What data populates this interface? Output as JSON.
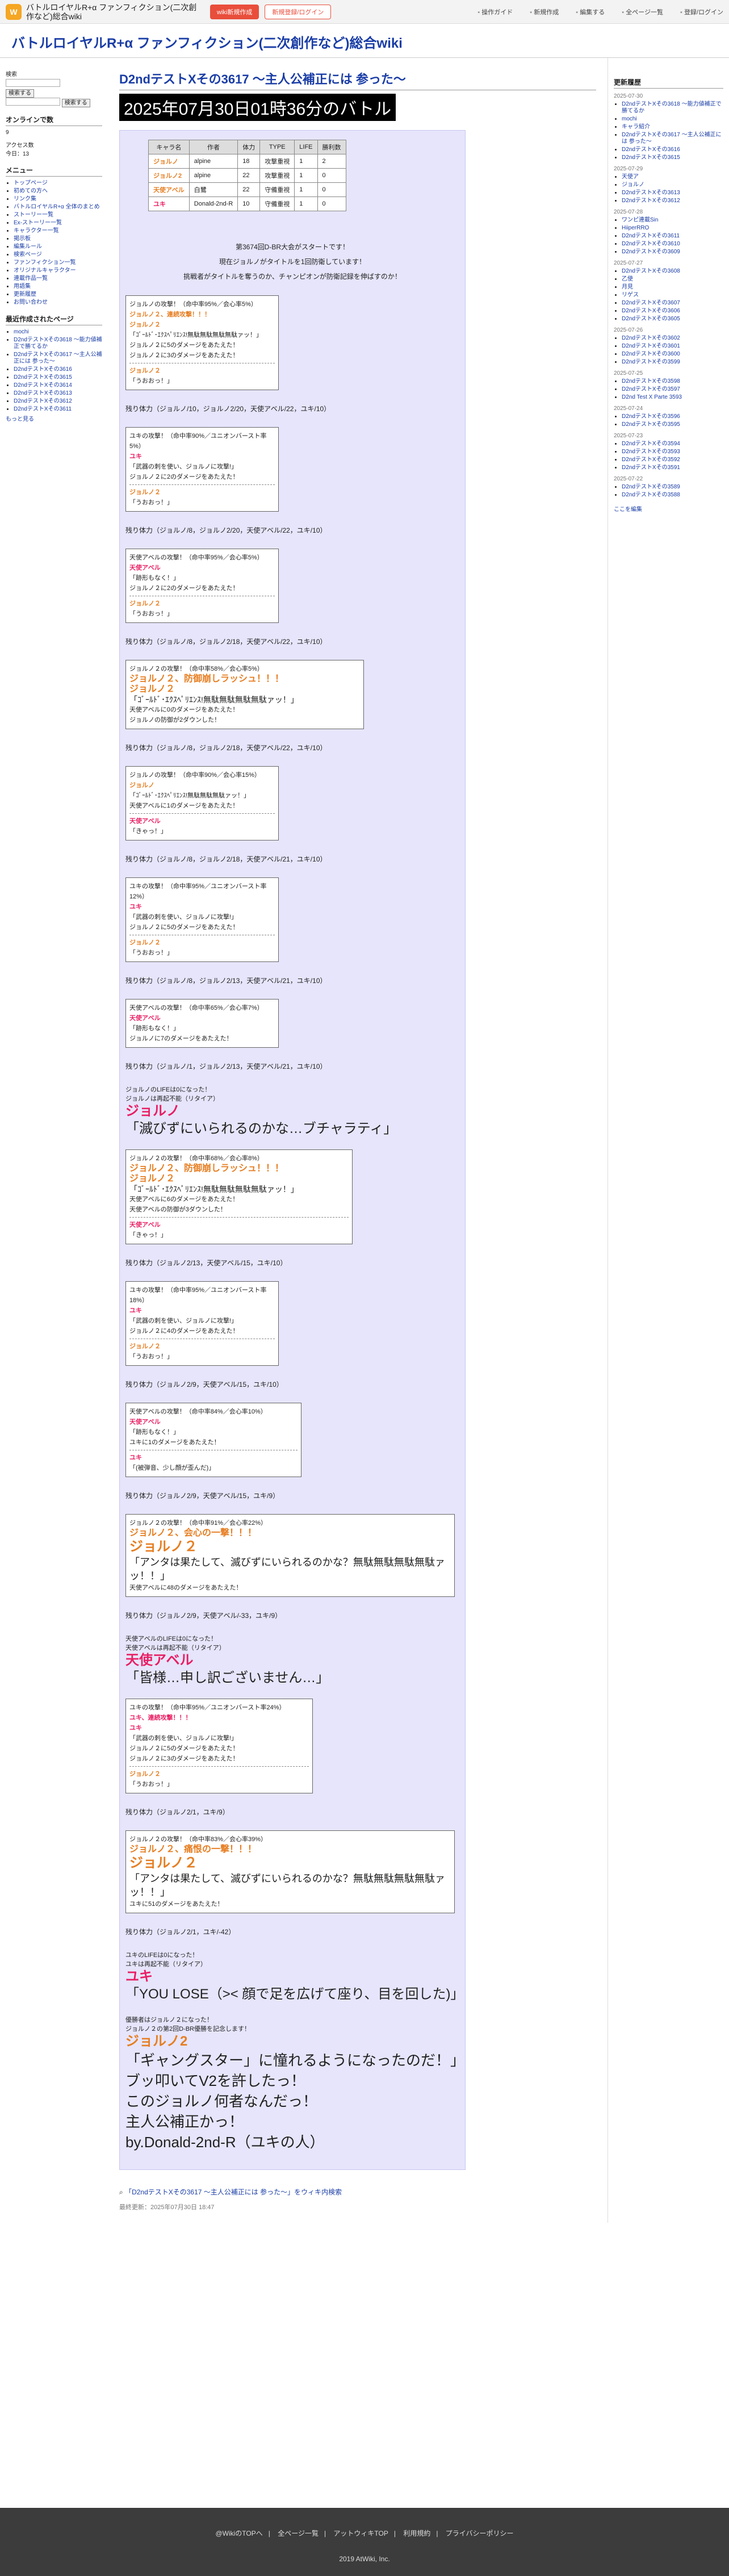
{
  "topbar": {
    "logo": "W",
    "wiki_name": "バトルロイヤルR+α ファンフィクション(二次創作など)総合wiki",
    "btn_new": "wiki新規作成",
    "btn_login": "新規登録/ログイン",
    "nav": [
      "操作ガイド",
      "新規作成",
      "編集する",
      "全ページ一覧",
      "登録/ログイン"
    ]
  },
  "header": {
    "title": "バトルロイヤルR+α ファンフィクション(二次創作など)総合wiki"
  },
  "left": {
    "search_head": "検索",
    "search_btn": "検索する",
    "search_btn2": "検索する",
    "online_head": "オンラインで数",
    "online_count": "9",
    "access_head": "アクセス数",
    "access_today": "今日：13",
    "menu_head": "メニュー",
    "menu": [
      "トップページ",
      "初めての方へ",
      "リンク集",
      "バトルロイヤルR+α 全体のまとめ",
      "ストーリー一覧",
      "Ex-ストーリー一覧",
      "キャラクター一覧",
      "掲示板",
      "編集ルール",
      "検索ページ",
      "ファンフィクション一覧",
      "オリジナルキャラクター",
      "連載作品一覧",
      "用語集",
      "更新履歴",
      "お問い合わせ"
    ],
    "recent_head": "最近作成されたページ",
    "recent": [
      "mochi",
      "D2ndテストXその3618 〜能力値補正で勝てるか",
      "D2ndテストXその3617 〜主人公補正には 参った〜",
      "D2ndテストXその3616",
      "D2ndテストXその3615",
      "D2ndテストXその3614",
      "D2ndテストXその3613",
      "D2ndテストXその3612",
      "D2ndテストXその3611"
    ],
    "more": "もっと見る"
  },
  "main": {
    "page_title": "D2ndテストXその3617 〜主人公補正には 参った〜",
    "banner": "2025年07月30日01時36分のバトル",
    "table_head": [
      "キャラ名",
      "作者",
      "体力",
      "TYPE",
      "LIFE",
      "勝利数"
    ],
    "table_rows": [
      [
        "ジョルノ",
        "alpine",
        "18",
        "攻撃重視",
        "1",
        "2"
      ],
      [
        "ジョルノ2",
        "alpine",
        "22",
        "攻撃重視",
        "1",
        "0"
      ],
      [
        "天使アベル",
        "白鷺",
        "22",
        "守備重視",
        "1",
        "0"
      ],
      [
        "ユキ",
        "Donald-2nd-R",
        "10",
        "守備重視",
        "1",
        "0"
      ]
    ],
    "intro1": "第3674回D-BR大会がスタートです！",
    "intro2": "現在ジョルノがタイトルを1回防衛しています！",
    "intro3": "挑戦者がタイトルを奪うのか、チャンピオンが防衛記録を伸ばすのか！",
    "atk1": [
      "ジョルノの攻撃！（命中率95%／会心率5%）",
      "ジョルノ２、連続攻撃！！！",
      "ジョルノ２",
      "「ｺﾞｰﾙﾄﾞ･ｴｸｽﾍﾟﾘｴﾝｽ!無駄無駄無駄無駄ァッ！」",
      "ジョルノ２に5のダメージをあたえた！",
      "ジョルノ２に3のダメージをあたえた！",
      "ジョルノ２",
      "「うおおっ！」"
    ],
    "hp1": "残り体力（ジョルノ/10，ジョルノ2/20，天使アベル/22，ユキ/10）",
    "atk2": [
      "ユキの攻撃！（命中率90%／ユニオンバースト率5%）",
      "ユキ",
      "「武器の刺を使い、ジョルノに攻撃!」",
      "ジョルノ２に2のダメージをあたえた！",
      "ジョルノ２",
      "「うおおっ！」"
    ],
    "hp2": "残り体力（ジョルノ/8，ジョルノ2/20，天使アベル/22，ユキ/10）",
    "atk3": [
      "天使アベルの攻撃！（命中率95%／会心率5%）",
      "天使アベル",
      "「跡形もなく！」",
      "ジョルノ２に2のダメージをあたえた！",
      "ジョルノ２",
      "「うおおっ！」"
    ],
    "hp3": "残り体力（ジョルノ/8，ジョルノ2/18，天使アベル/22，ユキ/10）",
    "atk4": [
      "ジョルノ２の攻撃！（命中率58%／会心率5%）",
      "ジョルノ２、防御崩しラッシュ！！！",
      "ジョルノ２",
      "「ｺﾞｰﾙﾄﾞ･ｴｸｽﾍﾟﾘｴﾝｽ!無駄無駄無駄無駄ァッ！」",
      "天使アベルに0のダメージをあたえた！",
      "ジョルノの防御が2ダウンした！"
    ],
    "hp4": "残り体力（ジョルノ/8，ジョルノ2/18，天使アベル/22，ユキ/10）",
    "atk5": [
      "ジョルノの攻撃！（命中率90%／会心率15%）",
      "ジョルノ",
      "「ｺﾞｰﾙﾄﾞ･ｴｸｽﾍﾟﾘｴﾝｽ!無駄無駄無駄ァッ！」",
      "天使アベルに1のダメージをあたえた！",
      "天使アベル",
      "「きゃっ！」"
    ],
    "hp5": "残り体力（ジョルノ/8，ジョルノ2/18，天使アベル/21，ユキ/10）",
    "atk6": [
      "ユキの攻撃！（命中率95%／ユニオンバースト率12%）",
      "ユキ",
      "「武器の刺を使い、ジョルノに攻撃!」",
      "ジョルノ２に5のダメージをあたえた！",
      "ジョルノ２",
      "「うおおっ！」"
    ],
    "hp6": "残り体力（ジョルノ/8，ジョルノ2/13，天使アベル/21，ユキ/10）",
    "atk7": [
      "天使アベルの攻撃！（命中率65%／会心率7%）",
      "天使アベル",
      "「跡形もなく！」",
      "ジョルノに7のダメージをあたえた！"
    ],
    "hp7": "残り体力（ジョルノ/1，ジョルノ2/13，天使アベル/21，ユキ/10）",
    "death1": [
      "ジョルノのLIFEは0になった！",
      "ジョルノは再起不能（リタイア）"
    ],
    "death1_name": "ジョルノ",
    "death1_quote": "「滅びずにいられるのかな…ブチャラティ」",
    "atk8": [
      "ジョルノ２の攻撃！（命中率68%／会心率8%）",
      "ジョルノ２、防御崩しラッシュ！！！",
      "ジョルノ２",
      "「ｺﾞｰﾙﾄﾞ･ｴｸｽﾍﾟﾘｴﾝｽ!無駄無駄無駄無駄ァッ！」",
      "天使アベルに6のダメージをあたえた！",
      "天使アベルの防御が3ダウンした！",
      "天使アベル",
      "「きゃっ！」"
    ],
    "hp8": "残り体力（ジョルノ2/13，天使アベル/15，ユキ/10）",
    "atk9": [
      "ユキの攻撃！（命中率95%／ユニオンバースト率18%）",
      "ユキ",
      "「武器の刺を使い、ジョルノに攻撃!」",
      "ジョルノ２に4のダメージをあたえた！",
      "ジョルノ２",
      "「うおおっ！」"
    ],
    "hp9": "残り体力（ジョルノ2/9，天使アベル/15，ユキ/10）",
    "atk10": [
      "天使アベルの攻撃！（命中率84%／会心率10%）",
      "天使アベル",
      "「跡形もなく！」",
      "ユキに1のダメージをあたえた！",
      "ユキ",
      "「(被弾音、少し顔が歪んだ)」"
    ],
    "hp10": "残り体力（ジョルノ2/9，天使アベル/15，ユキ/9）",
    "atk11_line1": "ジョルノ２の攻撃！（命中率91%／会心率22%）",
    "atk11_line2": "ジョルノ２、会心の一撃！！！",
    "atk11_name": "ジョルノ２",
    "atk11_quote": "「アンタは果たして、滅びずにいられるのかな？無駄無駄無駄無駄ァッ！！」",
    "atk11_dmg": "天使アベルに48のダメージをあたえた！",
    "hp11": "残り体力（ジョルノ2/9，天使アベル/-33，ユキ/9）",
    "death2": [
      "天使アベルのLIFEは0になった！",
      "天使アベルは再起不能（リタイア）"
    ],
    "death2_name": "天使アベル",
    "death2_quote": "「皆様…申し訳ございません…」",
    "atk12": [
      "ユキの攻撃！（命中率95%／ユニオンバースト率24%）",
      "ユキ、連続攻撃！！！",
      "ユキ",
      "「武器の刺を使い、ジョルノに攻撃!」",
      "ジョルノ２に5のダメージをあたえた！",
      "ジョルノ２に3のダメージをあたえた！",
      "ジョルノ２",
      "「うおおっ！」"
    ],
    "hp12": "残り体力（ジョルノ2/1，ユキ/9）",
    "atk13_line1": "ジョルノ２の攻撃！（命中率83%／会心率39%）",
    "atk13_line2": "ジョルノ２、痛恨の一撃！！！",
    "atk13_name": "ジョルノ２",
    "atk13_quote": "「アンタは果たして、滅びずにいられるのかな？無駄無駄無駄無駄ァッ！！」",
    "atk13_dmg": "ユキに51のダメージをあたえた！",
    "hp13": "残り体力（ジョルノ2/1，ユキ/-42）",
    "death3": [
      "ユキのLIFEは0になった！",
      "ユキは再起不能（リタイア）"
    ],
    "death3_name": "ユキ",
    "death3_quote": "「YOU LOSE（>< 顔で足を広げて座り、目を回した)」",
    "win": [
      "優勝者はジョルノ２になった！",
      "ジョルノ２の第2回D-BR優勝を記念します！"
    ],
    "win_name": "ジョルノ2",
    "win_lines": [
      "「ギャングスター」に憧れるようになったのだ！」",
      "ブッ叩いてV2を許したっ！",
      "このジョルノ何者なんだっ！",
      "主人公補正かっ！",
      "by.Donald-2nd-R（ユキの人）"
    ],
    "bottom_link": "「D2ndテストXその3617 〜主人公補正には 参った〜」をウィキ内検索",
    "updated": "最終更新：2025年07月30日 18:47"
  },
  "right": {
    "head": "更新履歴",
    "groups": [
      {
        "date": "2025-07-30",
        "items": [
          "D2ndテストXその3618 〜能力値補正で勝てるか",
          "mochi",
          "キャラ紹介",
          "D2ndテストXその3617 〜主人公補正には 参った〜",
          "D2ndテストXその3616",
          "D2ndテストXその3615"
        ]
      },
      {
        "date": "2025-07-29",
        "items": [
          "天使ア",
          "ジョルノ",
          "D2ndテストXその3613",
          "D2ndテストXその3612"
        ]
      },
      {
        "date": "2025-07-28",
        "items": [
          "ワンピ連載Sin",
          "HiiperRRO",
          "D2ndテストXその3611",
          "D2ndテストXその3610",
          "D2ndテストXその3609"
        ]
      },
      {
        "date": "2025-07-27",
        "items": [
          "D2ndテストXその3608",
          "乙使",
          "月見",
          "リゲス",
          "D2ndテストXその3607",
          "D2ndテストXその3606",
          "D2ndテストXその3605"
        ]
      },
      {
        "date": "2025-07-26",
        "items": [
          "D2ndテストXその3602",
          "D2ndテストXその3601",
          "D2ndテストXその3600",
          "D2ndテストXその3599"
        ]
      },
      {
        "date": "2025-07-25",
        "items": [
          "D2ndテストXその3598",
          "D2ndテストXその3597",
          "D2nd Test X Parte 3593"
        ]
      },
      {
        "date": "2025-07-24",
        "items": [
          "D2ndテストXその3596",
          "D2ndテストXその3595"
        ]
      },
      {
        "date": "2025-07-23",
        "items": [
          "D2ndテストXその3594",
          "D2ndテストXその3593",
          "D2ndテストXその3592",
          "D2ndテストXその3591"
        ]
      },
      {
        "date": "2025-07-22",
        "items": [
          "D2ndテストXその3589",
          "D2ndテストXその3588"
        ]
      }
    ],
    "more": "ここを編集"
  },
  "footer": {
    "links": [
      "@WikiのTOPへ",
      "全ページ一覧",
      "アットウィキTOP",
      "利用規約",
      "プライバシーポリシー"
    ],
    "copyright": "2019 AtWiki, Inc."
  }
}
